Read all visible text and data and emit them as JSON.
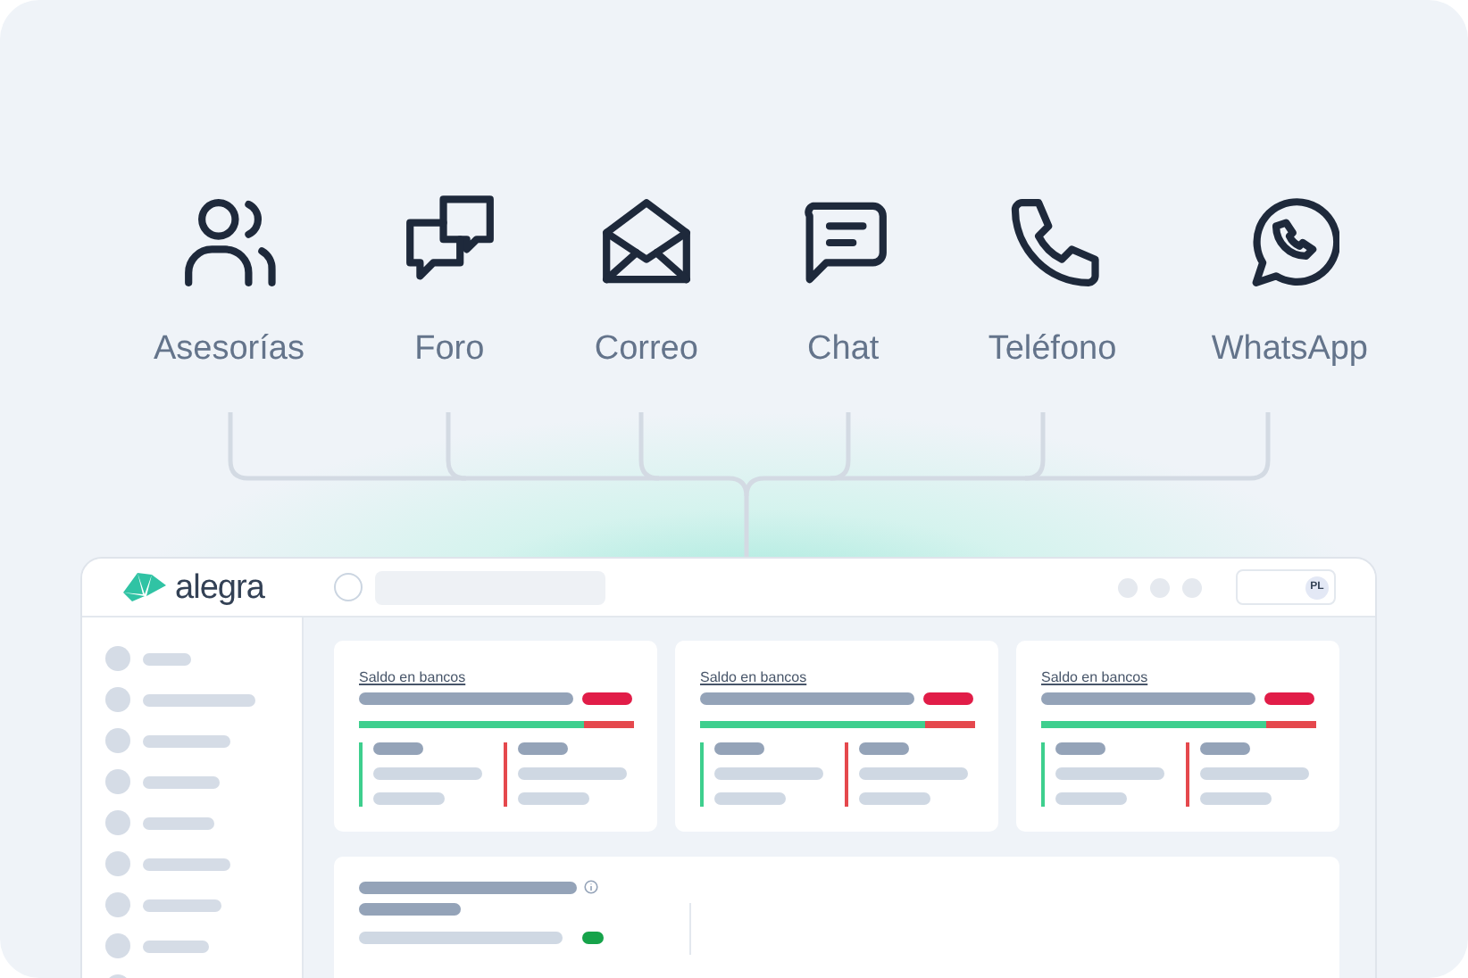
{
  "channels": [
    {
      "kind": "advisors",
      "label": "Asesorías"
    },
    {
      "kind": "forum",
      "label": "Foro"
    },
    {
      "kind": "mail",
      "label": "Correo"
    },
    {
      "kind": "chat",
      "label": "Chat"
    },
    {
      "kind": "phone",
      "label": "Teléfono"
    },
    {
      "kind": "whatsapp",
      "label": "WhatsApp"
    }
  ],
  "app": {
    "logo": "alegra",
    "avatar": "PL",
    "cards": [
      {
        "title": "Saldo en bancos",
        "level": 0.82
      },
      {
        "title": "Saldo en bancos",
        "level": 0.82
      },
      {
        "title": "Saldo en bancos",
        "level": 0.82
      }
    ]
  }
}
